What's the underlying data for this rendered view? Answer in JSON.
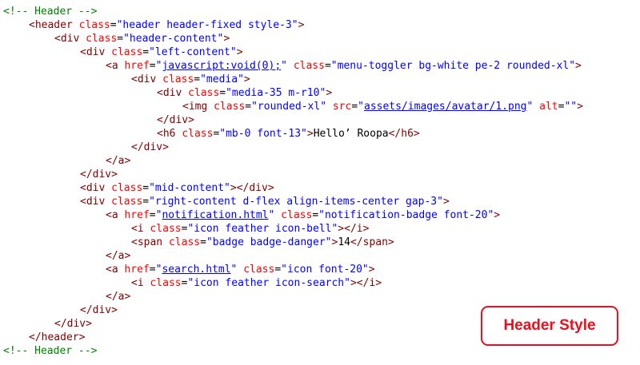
{
  "code_lines": [
    {
      "indent": 0,
      "parts": [
        [
          "c",
          "<!-- Header -->"
        ]
      ]
    },
    {
      "indent": 1,
      "parts": [
        [
          "t",
          "<header"
        ],
        [
          "x",
          " "
        ],
        [
          "a",
          "class"
        ],
        [
          "x",
          "="
        ],
        [
          "v",
          "\"header header-fixed style-3\""
        ],
        [
          "t",
          ">"
        ]
      ]
    },
    {
      "indent": 2,
      "parts": [
        [
          "t",
          "<div"
        ],
        [
          "x",
          " "
        ],
        [
          "a",
          "class"
        ],
        [
          "x",
          "="
        ],
        [
          "v",
          "\"header-content\""
        ],
        [
          "t",
          ">"
        ]
      ]
    },
    {
      "indent": 3,
      "parts": [
        [
          "t",
          "<div"
        ],
        [
          "x",
          " "
        ],
        [
          "a",
          "class"
        ],
        [
          "x",
          "="
        ],
        [
          "v",
          "\"left-content\""
        ],
        [
          "t",
          ">"
        ]
      ]
    },
    {
      "indent": 4,
      "parts": [
        [
          "t",
          "<a"
        ],
        [
          "x",
          " "
        ],
        [
          "a",
          "href"
        ],
        [
          "x",
          "="
        ],
        [
          "v",
          "\""
        ],
        [
          "u",
          "javascript:void(0);"
        ],
        [
          "v",
          "\""
        ],
        [
          "x",
          " "
        ],
        [
          "a",
          "class"
        ],
        [
          "x",
          "="
        ],
        [
          "v",
          "\"menu-toggler bg-white pe-2 rounded-xl\""
        ],
        [
          "t",
          ">"
        ]
      ]
    },
    {
      "indent": 5,
      "parts": [
        [
          "t",
          "<div"
        ],
        [
          "x",
          " "
        ],
        [
          "a",
          "class"
        ],
        [
          "x",
          "="
        ],
        [
          "v",
          "\"media\""
        ],
        [
          "t",
          ">"
        ]
      ]
    },
    {
      "indent": 6,
      "parts": [
        [
          "t",
          "<div"
        ],
        [
          "x",
          " "
        ],
        [
          "a",
          "class"
        ],
        [
          "x",
          "="
        ],
        [
          "v",
          "\"media-35 m-r10\""
        ],
        [
          "t",
          ">"
        ]
      ]
    },
    {
      "indent": 7,
      "parts": [
        [
          "t",
          "<img"
        ],
        [
          "x",
          " "
        ],
        [
          "a",
          "class"
        ],
        [
          "x",
          "="
        ],
        [
          "v",
          "\"rounded-xl\""
        ],
        [
          "x",
          " "
        ],
        [
          "a",
          "src"
        ],
        [
          "x",
          "="
        ],
        [
          "v",
          "\""
        ],
        [
          "u",
          "assets/images/avatar/1.png"
        ],
        [
          "v",
          "\""
        ],
        [
          "x",
          " "
        ],
        [
          "a",
          "alt"
        ],
        [
          "x",
          "="
        ],
        [
          "v",
          "\"\""
        ],
        [
          "t",
          ">"
        ]
      ]
    },
    {
      "indent": 6,
      "parts": [
        [
          "t",
          "</div>"
        ]
      ]
    },
    {
      "indent": 6,
      "parts": [
        [
          "t",
          "<h6"
        ],
        [
          "x",
          " "
        ],
        [
          "a",
          "class"
        ],
        [
          "x",
          "="
        ],
        [
          "v",
          "\"mb-0 font-13\""
        ],
        [
          "t",
          ">"
        ],
        [
          "x",
          "Hello’ Roopa"
        ],
        [
          "t",
          "</h6>"
        ]
      ]
    },
    {
      "indent": 5,
      "parts": [
        [
          "t",
          "</div>"
        ]
      ]
    },
    {
      "indent": 4,
      "parts": [
        [
          "t",
          "</a>"
        ]
      ]
    },
    {
      "indent": 3,
      "parts": [
        [
          "t",
          "</div>"
        ]
      ]
    },
    {
      "indent": 3,
      "parts": [
        [
          "t",
          "<div"
        ],
        [
          "x",
          " "
        ],
        [
          "a",
          "class"
        ],
        [
          "x",
          "="
        ],
        [
          "v",
          "\"mid-content\""
        ],
        [
          "t",
          "></div>"
        ]
      ]
    },
    {
      "indent": 3,
      "parts": [
        [
          "t",
          "<div"
        ],
        [
          "x",
          " "
        ],
        [
          "a",
          "class"
        ],
        [
          "x",
          "="
        ],
        [
          "v",
          "\"right-content d-flex align-items-center gap-3\""
        ],
        [
          "t",
          ">"
        ]
      ]
    },
    {
      "indent": 4,
      "parts": [
        [
          "t",
          "<a"
        ],
        [
          "x",
          " "
        ],
        [
          "a",
          "href"
        ],
        [
          "x",
          "="
        ],
        [
          "v",
          "\""
        ],
        [
          "u",
          "notification.html"
        ],
        [
          "v",
          "\""
        ],
        [
          "x",
          " "
        ],
        [
          "a",
          "class"
        ],
        [
          "x",
          "="
        ],
        [
          "v",
          "\"notification-badge font-20\""
        ],
        [
          "t",
          ">"
        ]
      ]
    },
    {
      "indent": 5,
      "parts": [
        [
          "t",
          "<i"
        ],
        [
          "x",
          " "
        ],
        [
          "a",
          "class"
        ],
        [
          "x",
          "="
        ],
        [
          "v",
          "\"icon feather icon-bell\""
        ],
        [
          "t",
          "></i>"
        ]
      ]
    },
    {
      "indent": 5,
      "parts": [
        [
          "t",
          "<span"
        ],
        [
          "x",
          " "
        ],
        [
          "a",
          "class"
        ],
        [
          "x",
          "="
        ],
        [
          "v",
          "\"badge badge-danger\""
        ],
        [
          "t",
          ">"
        ],
        [
          "x",
          "14"
        ],
        [
          "t",
          "</span>"
        ]
      ]
    },
    {
      "indent": 4,
      "parts": [
        [
          "t",
          "</a>"
        ]
      ]
    },
    {
      "indent": 4,
      "parts": [
        [
          "t",
          "<a"
        ],
        [
          "x",
          " "
        ],
        [
          "a",
          "href"
        ],
        [
          "x",
          "="
        ],
        [
          "v",
          "\""
        ],
        [
          "u",
          "search.html"
        ],
        [
          "v",
          "\""
        ],
        [
          "x",
          " "
        ],
        [
          "a",
          "class"
        ],
        [
          "x",
          "="
        ],
        [
          "v",
          "\"icon font-20\""
        ],
        [
          "t",
          ">"
        ]
      ]
    },
    {
      "indent": 5,
      "parts": [
        [
          "t",
          "<i"
        ],
        [
          "x",
          " "
        ],
        [
          "a",
          "class"
        ],
        [
          "x",
          "="
        ],
        [
          "v",
          "\"icon feather icon-search\""
        ],
        [
          "t",
          "></i>"
        ]
      ]
    },
    {
      "indent": 4,
      "parts": [
        [
          "t",
          "</a>"
        ]
      ]
    },
    {
      "indent": 3,
      "parts": [
        [
          "t",
          "</div>"
        ]
      ]
    },
    {
      "indent": 2,
      "parts": [
        [
          "t",
          "</div>"
        ]
      ]
    },
    {
      "indent": 1,
      "parts": [
        [
          "t",
          "</header>"
        ]
      ]
    },
    {
      "indent": 0,
      "parts": [
        [
          "c",
          "<!-- Header -->"
        ]
      ]
    }
  ],
  "label": {
    "text": "Header Style"
  },
  "colors": {
    "accent": "#e8101e",
    "tag": "#800000",
    "attr": "#ff0000",
    "value": "#0000ff",
    "comment": "#008000"
  }
}
